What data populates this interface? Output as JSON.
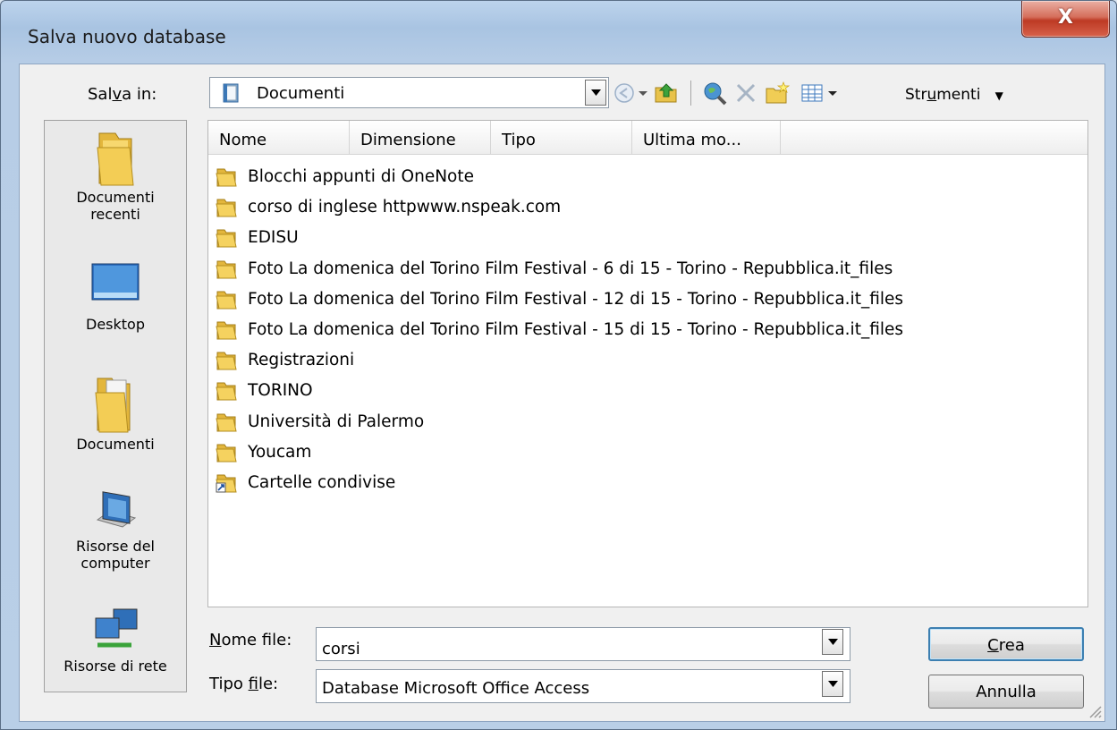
{
  "window": {
    "title": "Salva nuovo database",
    "close_label": "X"
  },
  "toolbar": {
    "save_in_label": "Salva in:",
    "location": "Documenti",
    "tools_label": "Strumenti",
    "icons": [
      "back-icon",
      "up-folder-icon",
      "search-web-icon",
      "delete-icon",
      "new-folder-icon",
      "views-icon"
    ]
  },
  "places": [
    {
      "label_line1": "Documenti",
      "label_line2": "recenti",
      "icon": "recent-documents-icon"
    },
    {
      "label_line1": "Desktop",
      "label_line2": "",
      "icon": "desktop-icon"
    },
    {
      "label_line1": "Documenti",
      "label_line2": "",
      "icon": "documents-icon"
    },
    {
      "label_line1": "Risorse del",
      "label_line2": "computer",
      "icon": "computer-icon"
    },
    {
      "label_line1": "Risorse di rete",
      "label_line2": "",
      "icon": "network-icon"
    }
  ],
  "columns": [
    "Nome",
    "Dimensione",
    "Tipo",
    "Ultima mo..."
  ],
  "files": [
    {
      "name": "Blocchi appunti di OneNote",
      "icon": "folder-icon"
    },
    {
      "name": "corso di inglese  httpwww.nspeak.com",
      "icon": "folder-icon"
    },
    {
      "name": "EDISU",
      "icon": "folder-icon"
    },
    {
      "name": "Foto La domenica del Torino Film Festival - 6 di 15 - Torino - Repubblica.it_files",
      "icon": "folder-icon"
    },
    {
      "name": "Foto La domenica del Torino Film Festival - 12 di 15 - Torino - Repubblica.it_files",
      "icon": "folder-icon"
    },
    {
      "name": "Foto La domenica del Torino Film Festival - 15 di 15 - Torino - Repubblica.it_files",
      "icon": "folder-icon"
    },
    {
      "name": "Registrazioni",
      "icon": "folder-icon"
    },
    {
      "name": "TORINO",
      "icon": "folder-icon"
    },
    {
      "name": "Università di Palermo",
      "icon": "folder-icon"
    },
    {
      "name": "Youcam",
      "icon": "folder-icon"
    },
    {
      "name": "Cartelle condivise",
      "icon": "shortcut-folder-icon"
    }
  ],
  "form": {
    "file_name_label": "Nome file:",
    "file_name_value": "corsi",
    "file_type_label": "Tipo file:",
    "file_type_value": "Database Microsoft Office Access",
    "create_label": "Crea",
    "cancel_label": "Annulla"
  }
}
